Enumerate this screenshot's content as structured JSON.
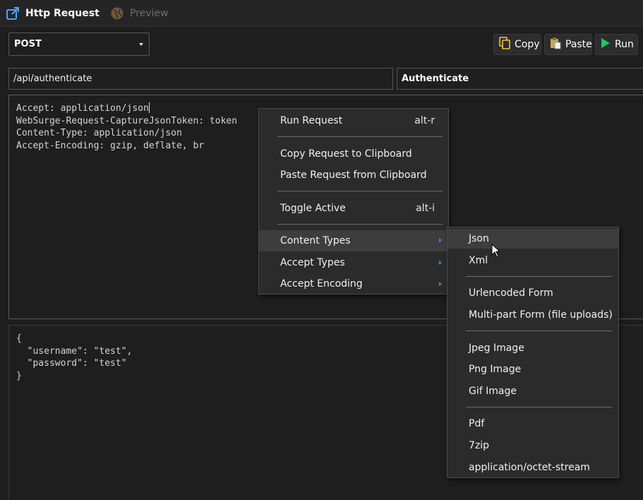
{
  "tabs": {
    "active": "Http Request",
    "inactive": "Preview"
  },
  "request": {
    "method": "POST",
    "url": "/api/authenticate",
    "name": "Authenticate"
  },
  "toolbar": {
    "copy_label": "Copy",
    "paste_label": "Paste",
    "run_label": "Run"
  },
  "headers": [
    "Accept: application/json",
    "WebSurge-Request-CaptureJsonToken: token",
    "Content-Type: application/json",
    "Accept-Encoding: gzip, deflate, br"
  ],
  "body": [
    "{",
    "  \"username\": \"test\",",
    "  \"password\": \"test\"",
    "}"
  ],
  "context_menu": {
    "run_request": "Run Request",
    "run_request_shortcut": "alt-r",
    "copy_request": "Copy Request to Clipboard",
    "paste_request": "Paste Request from Clipboard",
    "toggle_active": "Toggle Active",
    "toggle_active_shortcut": "alt-i",
    "content_types": "Content Types",
    "accept_types": "Accept Types",
    "accept_encoding": "Accept Encoding"
  },
  "content_types_menu": {
    "json": "Json",
    "xml": "Xml",
    "urlencoded": "Urlencoded Form",
    "multipart": "Multi-part Form (file uploads)",
    "jpeg": "Jpeg Image",
    "png": "Png Image",
    "gif": "Gif Image",
    "pdf": "Pdf",
    "zip": "7zip",
    "octet": "application/octet-stream"
  },
  "colors": {
    "background": "#1e1e1e",
    "menu_background": "#2b2b2b",
    "menu_hover": "#3d3d3d",
    "submenu_arrow": "#3b82f6",
    "run_icon": "#22c55e",
    "copy_icon": "#f5c542"
  },
  "icons": {
    "request_tab": "external-link-icon",
    "preview_tab": "globe-icon",
    "copy": "copy-icon",
    "paste": "paste-icon",
    "run": "play-icon"
  }
}
